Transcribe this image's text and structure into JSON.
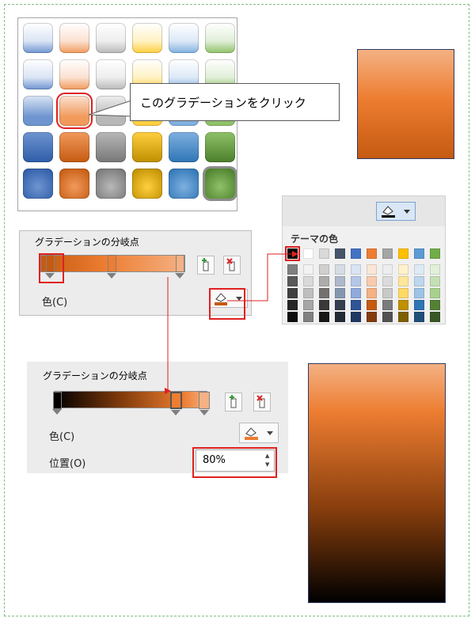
{
  "callout_text": "このグラデーションをクリック",
  "panel1": {
    "title": "グラデーションの分岐点",
    "color_label": "色(C)"
  },
  "palette": {
    "title": "テーマの色",
    "top_row": [
      "#000000",
      "#ffffff",
      "#d9d9d9",
      "#44546a",
      "#4472c4",
      "#ed7d31",
      "#a5a5a5",
      "#ffc000",
      "#5b9bd5",
      "#70ad47"
    ],
    "shade_rows": [
      [
        "#7f7f7f",
        "#f2f2f2",
        "#d0cece",
        "#d6dce4",
        "#dae3f3",
        "#fbe5d6",
        "#ededed",
        "#fff2cc",
        "#deebf7",
        "#e2f0d9"
      ],
      [
        "#595959",
        "#d9d9d9",
        "#aeabab",
        "#adb9ca",
        "#b4c7e7",
        "#f8cbad",
        "#dbdbdb",
        "#ffe699",
        "#bdd7ee",
        "#c5e0b4"
      ],
      [
        "#404040",
        "#bfbfbf",
        "#757171",
        "#8497b0",
        "#8faadc",
        "#f4b183",
        "#c9c9c9",
        "#ffd966",
        "#9dc3e6",
        "#a9d18e"
      ],
      [
        "#262626",
        "#a6a6a6",
        "#3a3838",
        "#333f50",
        "#2f5597",
        "#c55a11",
        "#7b7b7b",
        "#bf9000",
        "#2e75b6",
        "#548235"
      ],
      [
        "#0d0d0d",
        "#808080",
        "#171717",
        "#222a35",
        "#203864",
        "#843c0c",
        "#525252",
        "#7f6000",
        "#1f4e79",
        "#385723"
      ]
    ]
  },
  "panel2": {
    "title": "グラデーションの分岐点",
    "color_label": "色(C)",
    "position_label": "位置(O)",
    "position_value": "80%"
  },
  "colors": {
    "accent_orange": "#ed7d31",
    "dark_orange": "#c55a11",
    "highlight_red": "#e02020"
  }
}
